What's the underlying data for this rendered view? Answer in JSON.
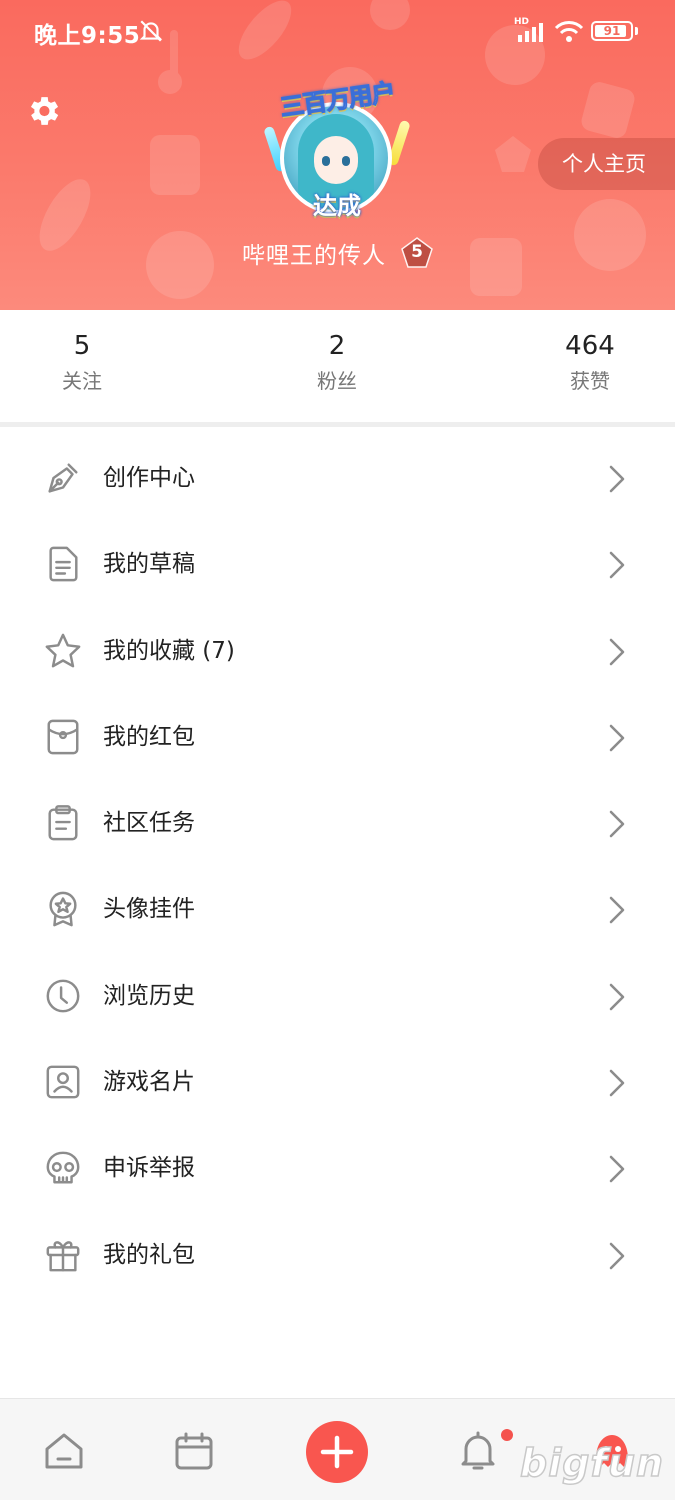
{
  "status_bar": {
    "time": "晚上9:55",
    "network": "HD",
    "battery_level": "91",
    "battery_fraction": 0.91
  },
  "colors": {
    "header_primary": "#fa6a5e",
    "accent": "#f9564f",
    "icon_gray": "#8c8c8c"
  },
  "header": {
    "settings_icon": "gear-icon",
    "avatar_badge_top": "三百万用户",
    "avatar_badge_bottom": "达成",
    "username": "哔哩王的传人",
    "level": "5",
    "homepage_button": "个人主页"
  },
  "stats": [
    {
      "value": "5",
      "label": "关注"
    },
    {
      "value": "2",
      "label": "粉丝"
    },
    {
      "value": "464",
      "label": "获赞"
    }
  ],
  "menu": [
    {
      "label": "创作中心",
      "icon": "pen-nib-icon"
    },
    {
      "label": "我的草稿",
      "icon": "draft-document-icon"
    },
    {
      "label": "我的收藏 (7)",
      "icon": "star-icon"
    },
    {
      "label": "我的红包",
      "icon": "red-packet-icon"
    },
    {
      "label": "社区任务",
      "icon": "clipboard-task-icon"
    },
    {
      "label": "头像挂件",
      "icon": "medal-badge-icon"
    },
    {
      "label": "浏览历史",
      "icon": "clock-icon"
    },
    {
      "label": "游戏名片",
      "icon": "profile-card-icon"
    },
    {
      "label": "申诉举报",
      "icon": "skull-icon"
    },
    {
      "label": "我的礼包",
      "icon": "gift-icon"
    }
  ],
  "bottom_nav": {
    "items": [
      "home-icon",
      "calendar-icon",
      "add-icon",
      "bell-icon",
      "mascot-profile-icon"
    ],
    "watermark": "bigfun"
  }
}
